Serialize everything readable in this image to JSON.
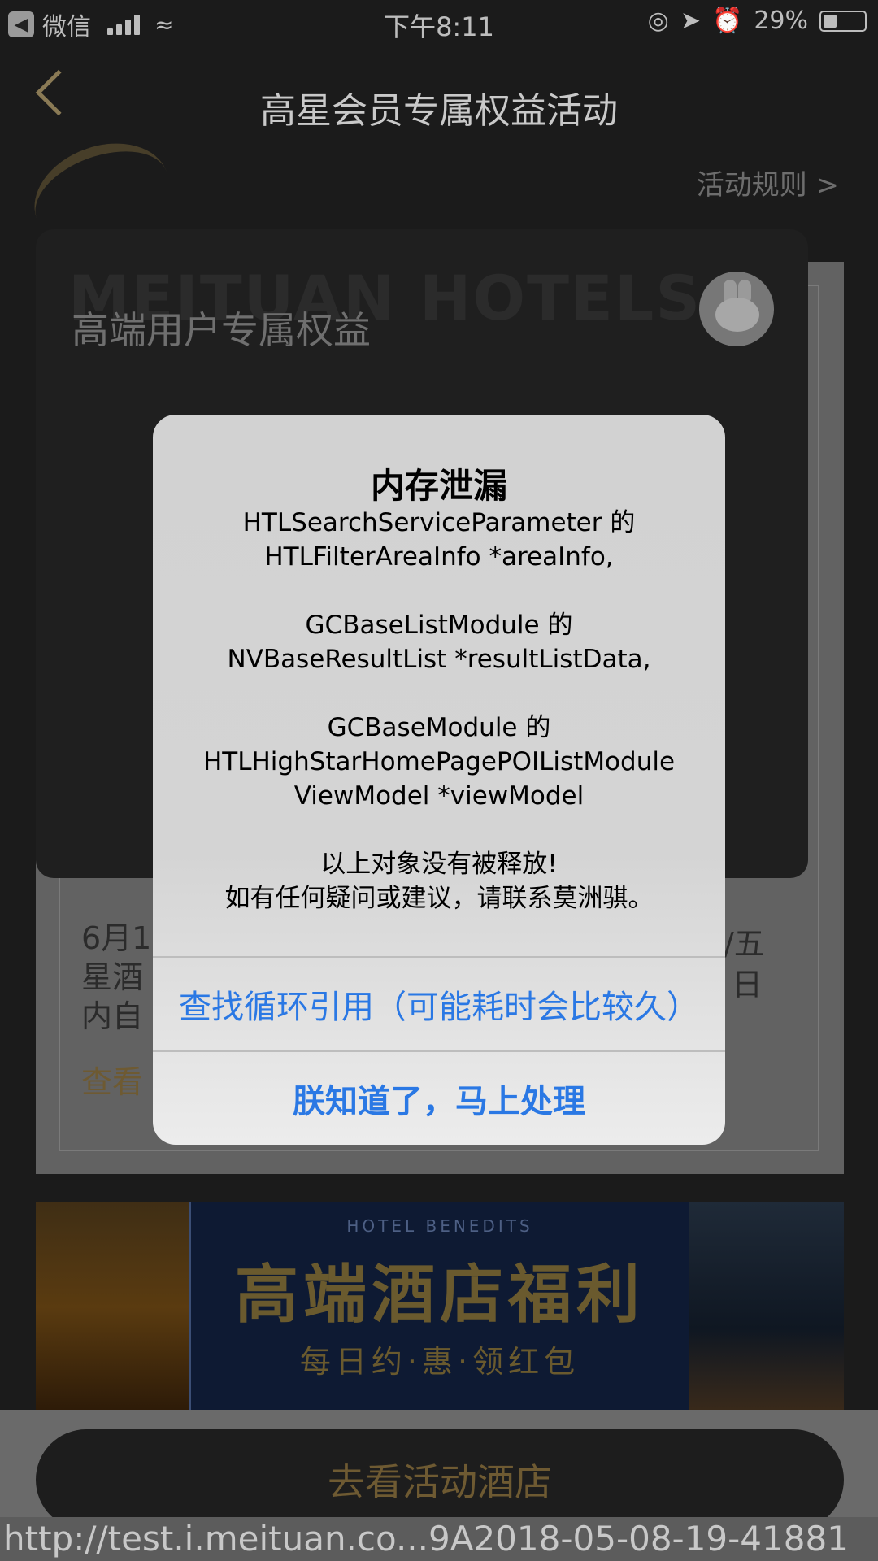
{
  "status_bar": {
    "back_app": "微信",
    "time": "下午8:11",
    "battery": "29%"
  },
  "nav": {
    "title": "高星会员专属权益活动",
    "rules_link": "活动规则 >"
  },
  "card": {
    "bg_word": "MEITUAN HOTELS",
    "subtitle": "高端用户专属权益",
    "text_lines": [
      "6月1",
      "星酒",
      "内自"
    ],
    "text_tail": [
      "/五",
      "日"
    ],
    "link": "查看"
  },
  "banner": {
    "eyebrow": "HOTEL BENEDITS",
    "main": "高端酒店福利",
    "sub": "每日约·惠·领红包"
  },
  "cta": {
    "label": "去看活动酒店"
  },
  "url": {
    "text": "http://test.i.meituan.co...9A2018-05-08-19-41881"
  },
  "alert": {
    "title": "内存泄漏",
    "message_lines": [
      "HTLSearchServiceParameter 的",
      "HTLFilterAreaInfo *areaInfo,",
      "",
      "GCBaseListModule 的",
      "NVBaseResultList *resultListData,",
      "",
      "GCBaseModule 的",
      "HTLHighStarHomePagePOIListModule",
      "ViewModel *viewModel",
      "",
      "以上对象没有被释放!",
      "如有任何疑问或建议，请联系莫洲骐。"
    ],
    "button_find_cycles": "查找循环引用（可能耗时会比较久）",
    "button_ok": "朕知道了，马上处理"
  }
}
